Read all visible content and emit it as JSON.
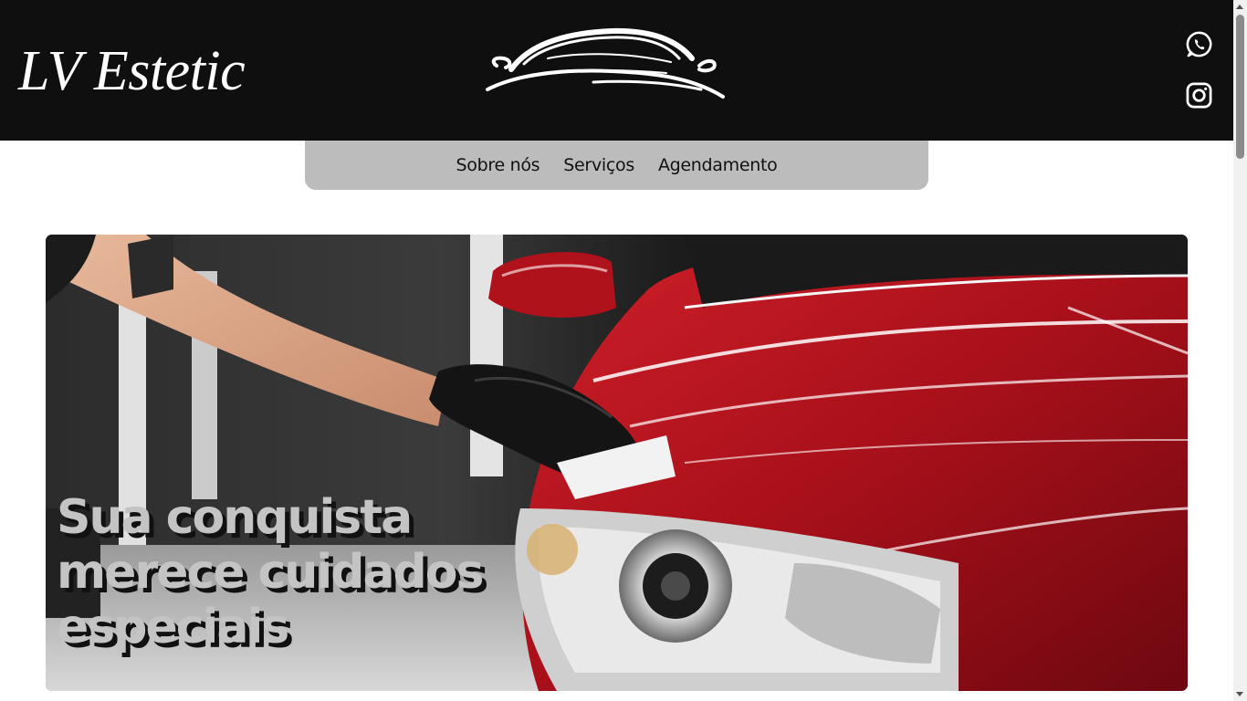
{
  "header": {
    "brand": "LV Estetic",
    "logo_icon": "car-silhouette-icon",
    "social": [
      {
        "name": "whatsapp-icon"
      },
      {
        "name": "instagram-icon"
      }
    ]
  },
  "nav": {
    "items": [
      {
        "label": "Sobre nós"
      },
      {
        "label": "Serviços"
      },
      {
        "label": "Agendamento"
      }
    ]
  },
  "hero": {
    "title": "Sua conquista merece cuidados especiais",
    "image": "gloved-hand-polishing-red-car-hood"
  },
  "colors": {
    "header_bg": "#0f0f0f",
    "nav_bg": "#bcbcbc",
    "hero_text": "#c4c4c4",
    "hero_shadow": "#111111",
    "car_red": "#b5121b"
  }
}
